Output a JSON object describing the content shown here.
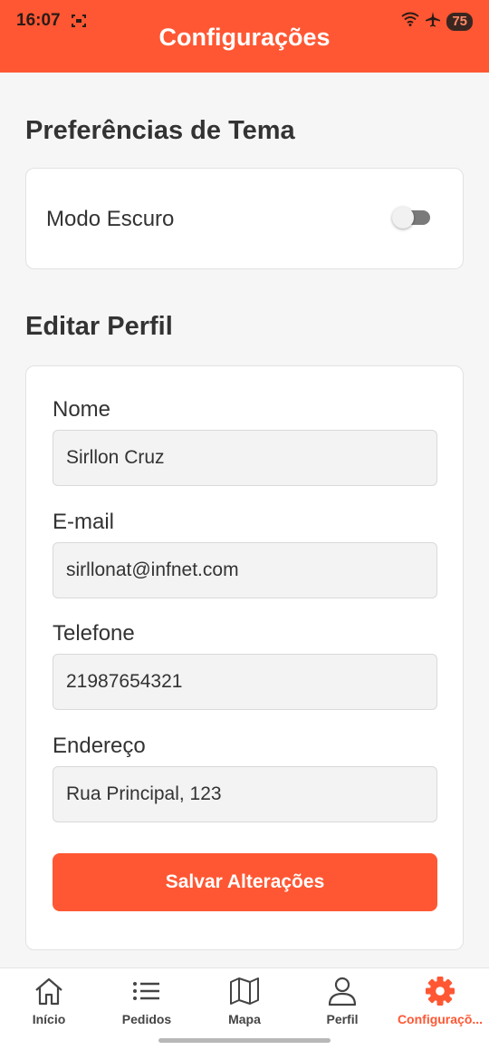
{
  "status_bar": {
    "time": "16:07",
    "battery": "75",
    "icons": [
      "screen-record-icon",
      "wifi-icon",
      "airplane-icon",
      "battery-icon"
    ]
  },
  "header": {
    "title": "Configurações"
  },
  "theme_section": {
    "title": "Preferências de Tema",
    "dark_mode_label": "Modo Escuro",
    "dark_mode_enabled": false
  },
  "profile_section": {
    "title": "Editar Perfil",
    "fields": [
      {
        "label": "Nome",
        "value": "Sirllon Cruz"
      },
      {
        "label": "E-mail",
        "value": "sirllonat@infnet.com"
      },
      {
        "label": "Telefone",
        "value": "21987654321"
      },
      {
        "label": "Endereço",
        "value": "Rua Principal, 123"
      }
    ],
    "save_label": "Salvar Alterações"
  },
  "tabbar": {
    "tabs": [
      {
        "label": "Início",
        "icon": "home-icon"
      },
      {
        "label": "Pedidos",
        "icon": "list-icon"
      },
      {
        "label": "Mapa",
        "icon": "map-icon"
      },
      {
        "label": "Perfil",
        "icon": "person-icon"
      },
      {
        "label": "Configuraçõ...",
        "icon": "gear-icon",
        "active": true
      }
    ]
  },
  "colors": {
    "accent": "#ff5733",
    "background": "#f6f6f6",
    "card": "#ffffff"
  }
}
